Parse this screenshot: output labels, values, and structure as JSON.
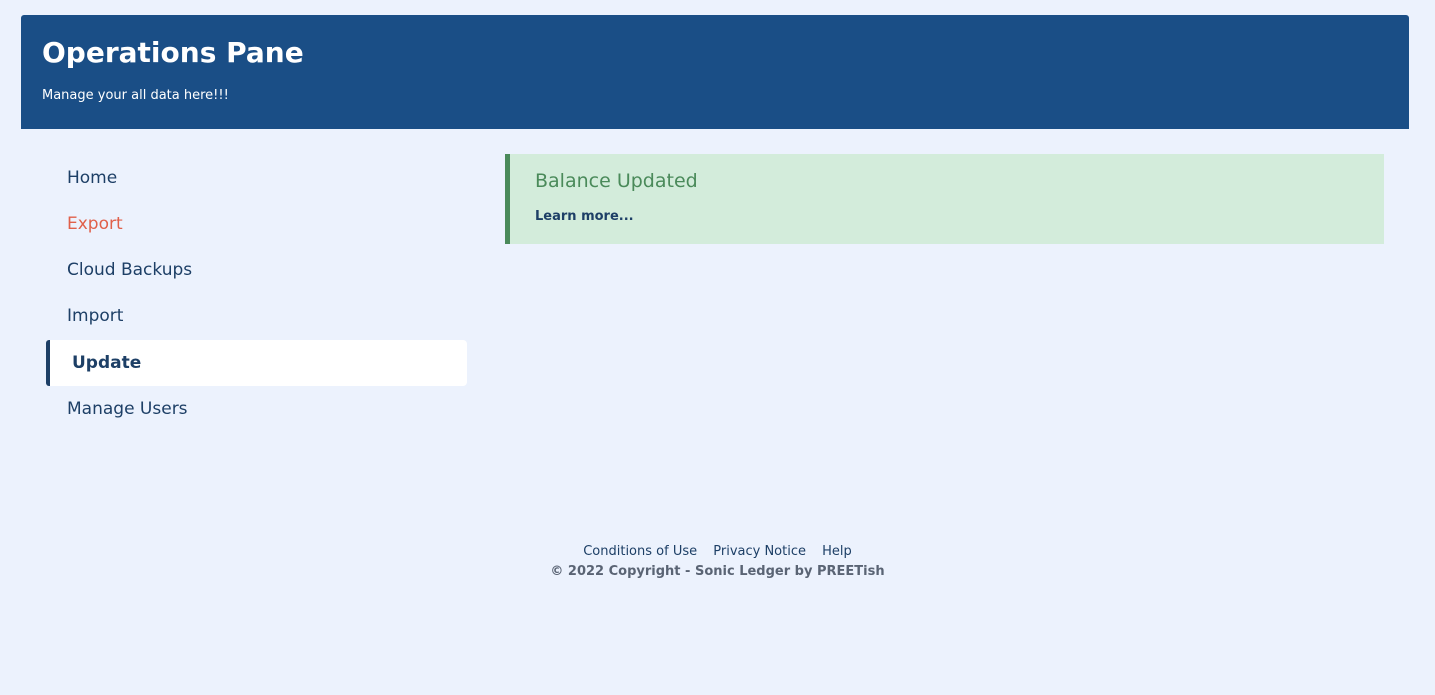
{
  "header": {
    "title": "Operations Pane",
    "subtitle": "Manage your all data here!!!"
  },
  "sidebar": {
    "items": [
      {
        "label": "Home"
      },
      {
        "label": "Export"
      },
      {
        "label": "Cloud Backups"
      },
      {
        "label": "Import"
      },
      {
        "label": "Update"
      },
      {
        "label": "Manage Users"
      }
    ],
    "active": "Update"
  },
  "alert": {
    "title": "Balance Updated",
    "link_label": "Learn more..."
  },
  "footer": {
    "links": [
      "Conditions of Use",
      "Privacy Notice",
      "Help"
    ],
    "copyright": "© 2022 Copyright - Sonic Ledger by PREETish"
  },
  "colors": {
    "header_bg": "#1a4e86",
    "page_bg": "#ecf2fd",
    "nav_text": "#1d3f66",
    "nav_highlight": "#e0604a",
    "alert_bg": "#d3ecdb",
    "alert_accent": "#4a8a5a"
  }
}
